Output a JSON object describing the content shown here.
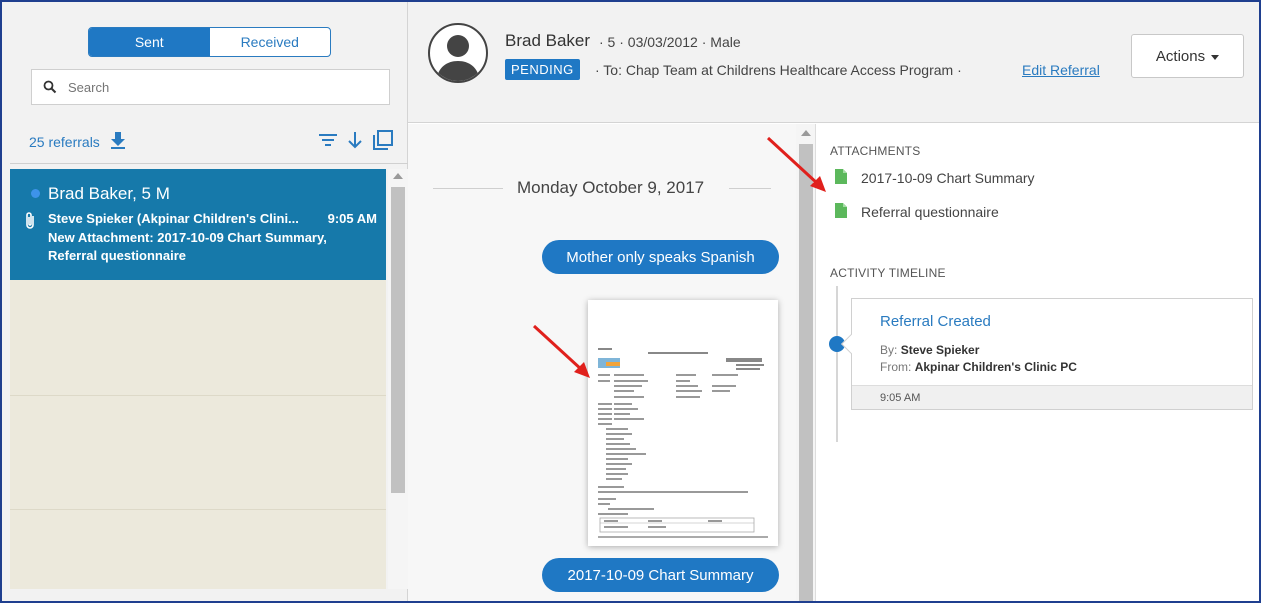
{
  "list_panel": {
    "tabs": [
      {
        "label": "Sent",
        "active": true
      },
      {
        "label": "Received",
        "active": false
      }
    ],
    "search": {
      "placeholder": "Search",
      "value": ""
    },
    "referral_count": "25 referrals",
    "items": [
      {
        "name": "Brad Baker, 5 M",
        "from": "Steve Spieker (Akpinar Children's Clini...",
        "time": "9:05 AM",
        "message": "New Attachment: 2017-10-09 Chart Summary, Referral questionnaire",
        "unread": true,
        "selected": true
      }
    ]
  },
  "header": {
    "patient_name": "Brad Baker",
    "patient_meta": "· 5 · 03/03/2012 · Male",
    "status": "PENDING",
    "to_text": "· To: Chap Team at Childrens Healthcare Access Program ·",
    "edit_link": "Edit Referral",
    "actions_label": "Actions"
  },
  "conversation": {
    "date": "Monday October 9, 2017",
    "messages": [
      "Mother only speaks Spanish"
    ],
    "attachment_caption": "2017-10-09 Chart Summary"
  },
  "details": {
    "attachments_heading": "ATTACHMENTS",
    "attachments": [
      "2017-10-09 Chart Summary",
      "Referral questionnaire"
    ],
    "timeline_heading": "ACTIVITY TIMELINE",
    "timeline": [
      {
        "title": "Referral Created",
        "by_label": "By:",
        "by": "Steve Spieker",
        "from_label": "From:",
        "from": "Akpinar Children's Clinic PC",
        "time": "9:05 AM"
      }
    ]
  },
  "colors": {
    "accent": "#1f78c4",
    "selected_item": "#1679aa",
    "file_icon": "#5cb85c",
    "annotation_arrow": "#e0201c"
  }
}
